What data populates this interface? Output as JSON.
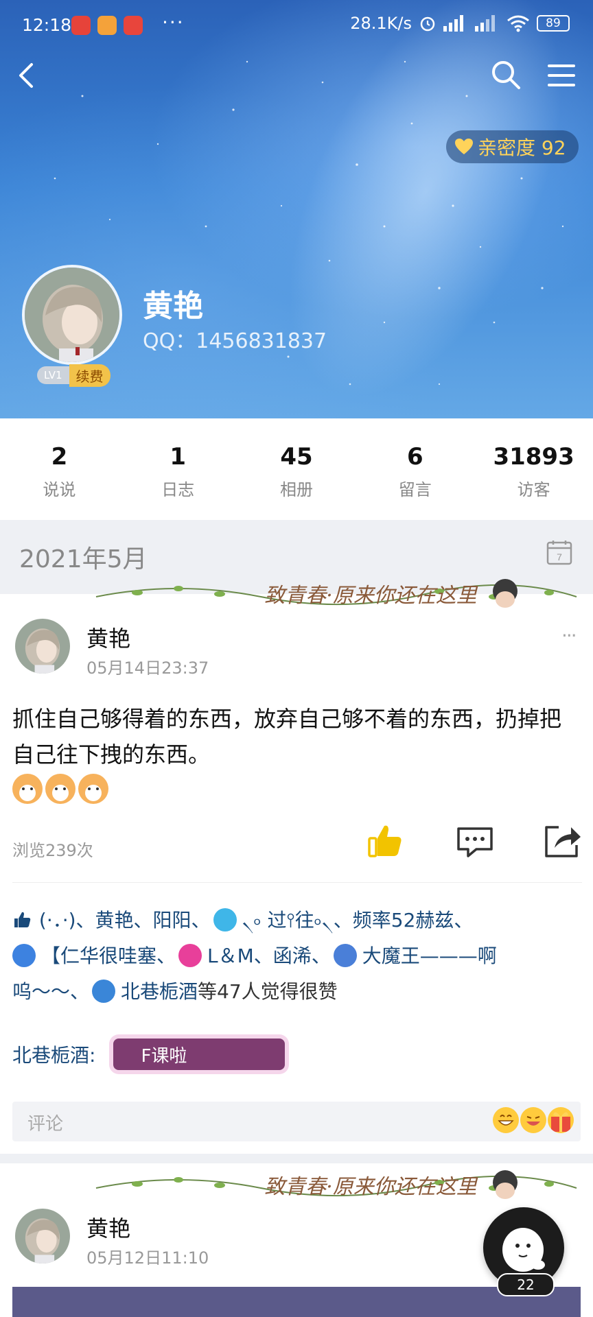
{
  "status_bar": {
    "time": "12:18",
    "dots": "···",
    "net_speed": "28.1K/s",
    "battery": "89"
  },
  "nav": {
    "back_icon": "chevron-left-icon",
    "search_icon": "search-icon",
    "menu_icon": "menu-icon"
  },
  "profile": {
    "intimacy_label": "亲密度 92",
    "name": "黄艳",
    "qq": "QQ：1456831837",
    "level": "LV1",
    "renew_label": "续费"
  },
  "stats": [
    {
      "value": "2",
      "label": "说说"
    },
    {
      "value": "1",
      "label": "日志"
    },
    {
      "value": "45",
      "label": "相册"
    },
    {
      "value": "6",
      "label": "留言"
    },
    {
      "value": "31893",
      "label": "访客"
    }
  ],
  "timeline": {
    "month": "2021年5月",
    "calendar_day": "7",
    "banner_text": "致青春·原来你还在这里"
  },
  "post1": {
    "author": "黄艳",
    "time": "05月14日23:37",
    "more": "···",
    "text": "抓住自己够得着的东西，放弃自己够不着的东西，扔掉把自己往下拽的东西。",
    "views": "浏览239次",
    "likes": {
      "part1": "(·．·)、黄艳、阳阳、",
      "part2": "৲৹ 过⫯往৹৲、频率52赫兹、",
      "part3": "【仁华很哇塞、",
      "part4": "L＆M、函浠、",
      "part5": "大魔王———啊",
      "part6": "呜～～、",
      "part7": "北巷栀酒",
      "part8": "等47人觉得很赞"
    },
    "comment": {
      "author": "北巷栀酒:",
      "content": "F课啦"
    },
    "comment_placeholder": "评论"
  },
  "post2": {
    "author": "黄艳",
    "time": "05月12日11:10"
  },
  "floating": {
    "count": "22"
  }
}
